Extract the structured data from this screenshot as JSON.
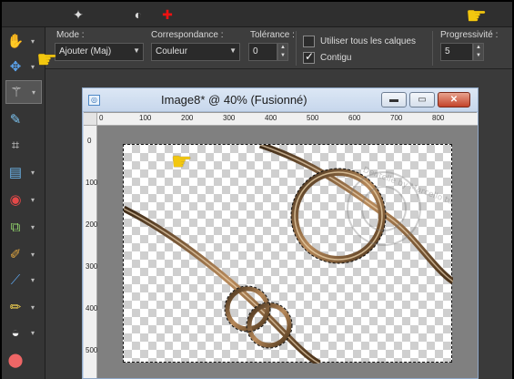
{
  "toolbar_top": {
    "icons": [
      "magic-wand-options-icon",
      "brush-colors-icon",
      "target-icon"
    ]
  },
  "options": {
    "mode_label": "Mode :",
    "mode_value": "Ajouter (Maj)",
    "match_label": "Correspondance :",
    "match_value": "Couleur",
    "tolerance_label": "Tolérance :",
    "tolerance_value": "0",
    "use_all_layers_label": "Utiliser tous les calques",
    "use_all_layers_checked": false,
    "contiguous_label": "Contigu",
    "contiguous_checked": true,
    "feather_label": "Progressivité :",
    "feather_value": "5"
  },
  "tools": [
    {
      "name": "pan-tool",
      "icon": "hand-icon"
    },
    {
      "name": "move-tool",
      "icon": "move-icon"
    },
    {
      "name": "magic-wand-tool",
      "icon": "magic-wand-icon",
      "active": true
    },
    {
      "name": "dropper-tool",
      "icon": "dropper-icon"
    },
    {
      "name": "crop-tool",
      "icon": "crop-icon"
    },
    {
      "name": "straighten-tool",
      "icon": "straighten-icon"
    },
    {
      "name": "red-eye-tool",
      "icon": "eye-icon"
    },
    {
      "name": "clone-tool",
      "icon": "clone-icon"
    },
    {
      "name": "paint-brush-tool",
      "icon": "brush-icon"
    },
    {
      "name": "scratch-remover-tool",
      "icon": "scratch-icon"
    },
    {
      "name": "pencil-tool",
      "icon": "pencil-icon"
    },
    {
      "name": "dodge-tool",
      "icon": "dodge-icon"
    },
    {
      "name": "fill-tool",
      "icon": "fill-icon"
    }
  ],
  "document": {
    "title": "Image8* @  40% (Fusionné)",
    "ruler_top": [
      "0",
      "100",
      "200",
      "300",
      "400",
      "500",
      "600",
      "700",
      "800"
    ],
    "ruler_left": [
      "0",
      "100",
      "200",
      "300",
      "400",
      "500"
    ],
    "watermark": "Dentelle by Marcello tutos"
  },
  "colors": {
    "pointer": "#f2c70f",
    "ring": "#6b4a2b"
  }
}
